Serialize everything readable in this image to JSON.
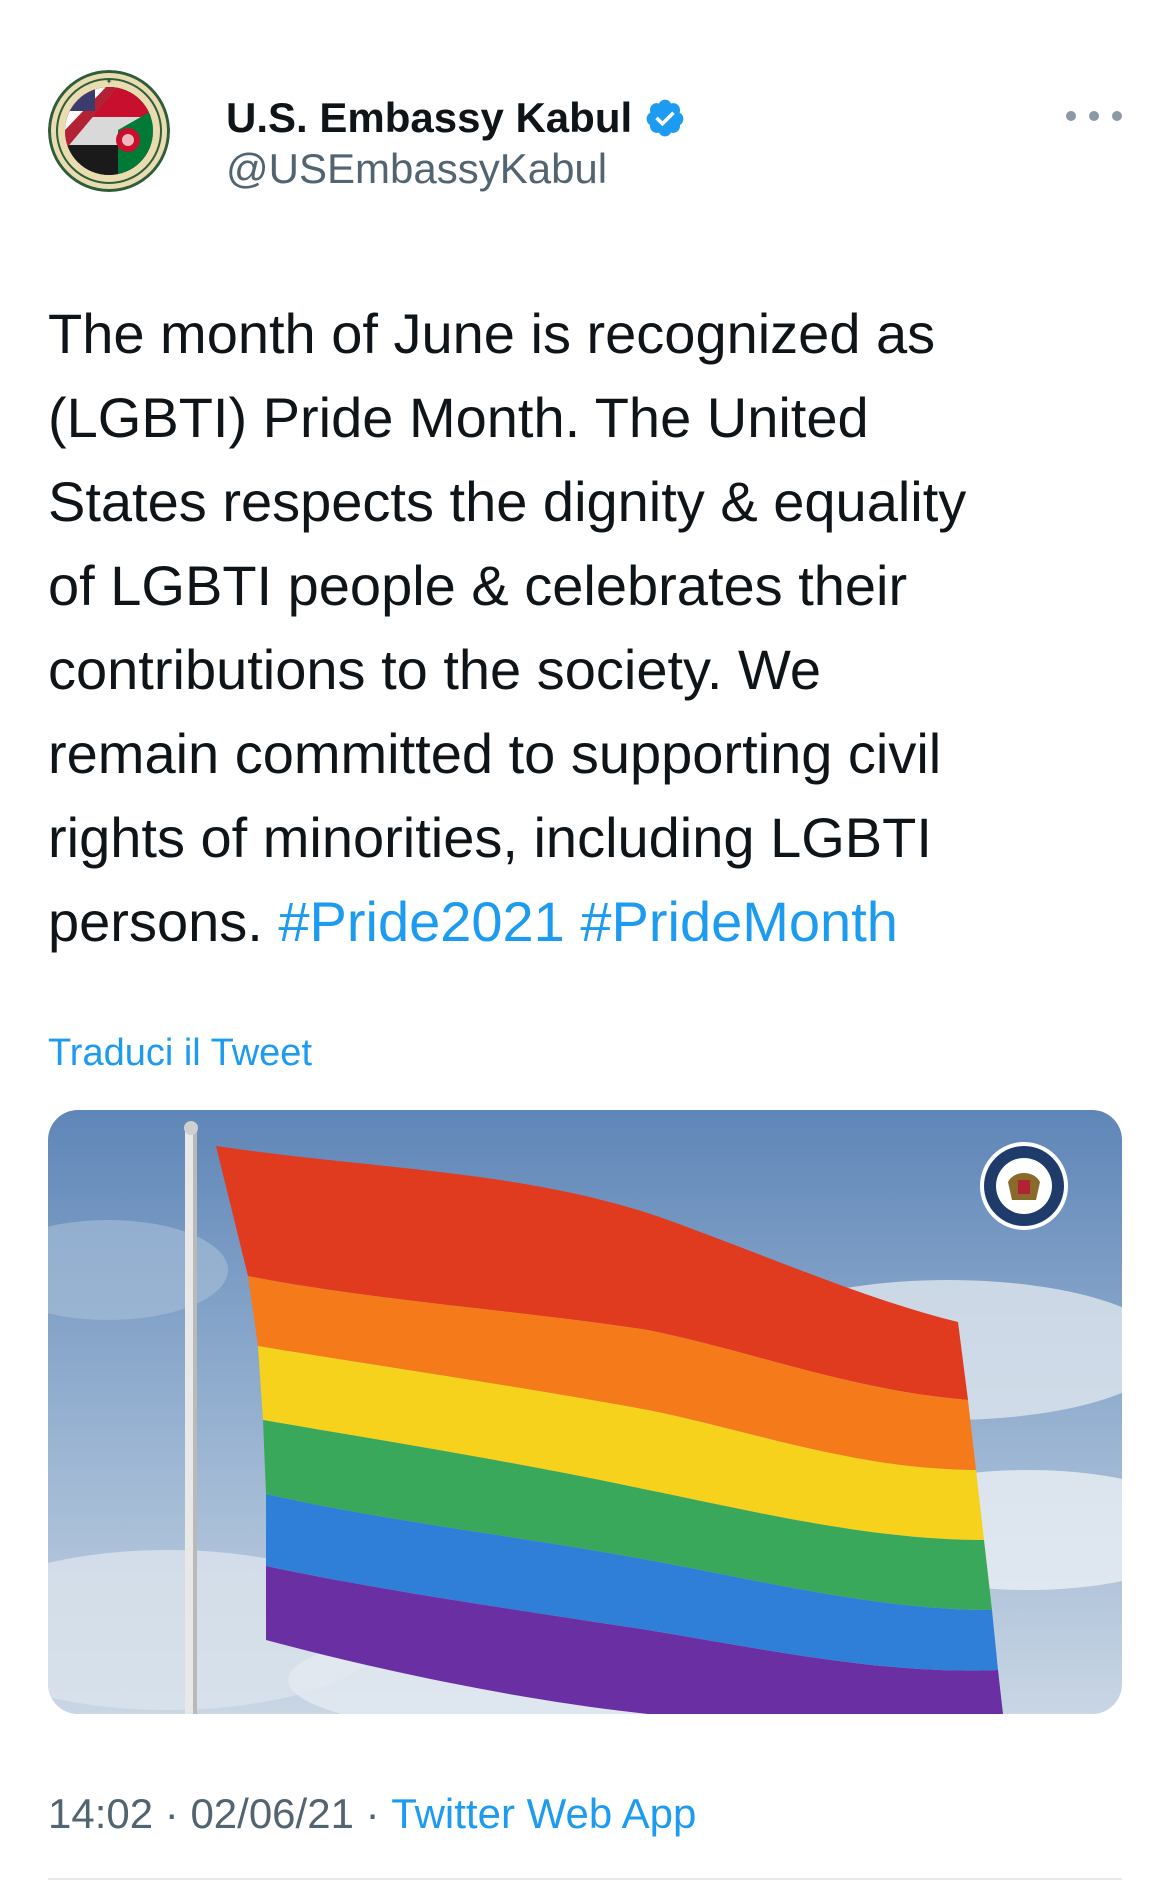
{
  "author": {
    "display_name": "U.S. Embassy Kabul",
    "handle": "@USEmbassyKabul",
    "avatar_icon": "embassy-seal-icon",
    "verified_icon": "verified-badge-icon"
  },
  "tweet": {
    "text_segments": [
      "The month of June is recognized as",
      "(LGBTI) Pride Month. The United",
      "States respects the dignity & equality",
      "of LGBTI people & celebrates their",
      "contributions to the society. We",
      "remain committed to supporting civil",
      "rights of minorities, including LGBTI",
      "persons."
    ],
    "hashtags": [
      "#Pride2021",
      "#PrideMonth"
    ],
    "translate_label": "Traduci il Tweet",
    "media_icon": "rainbow-flag-image"
  },
  "meta": {
    "time": "14:02",
    "separator": " · ",
    "date": "02/06/21",
    "source": "Twitter Web App"
  },
  "colors": {
    "link": "#1d9bf0",
    "secondary_text": "#536471",
    "primary_text": "#0f1419"
  }
}
